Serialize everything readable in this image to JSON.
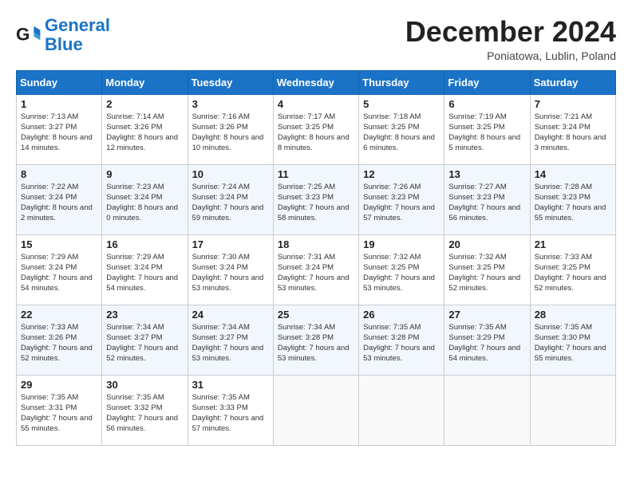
{
  "logo": {
    "line1": "General",
    "line2": "Blue"
  },
  "title": "December 2024",
  "subtitle": "Poniatowa, Lublin, Poland",
  "days_of_week": [
    "Sunday",
    "Monday",
    "Tuesday",
    "Wednesday",
    "Thursday",
    "Friday",
    "Saturday"
  ],
  "weeks": [
    [
      {
        "day": 1,
        "sunrise": "7:13 AM",
        "sunset": "3:27 PM",
        "daylight": "8 hours and 14 minutes."
      },
      {
        "day": 2,
        "sunrise": "7:14 AM",
        "sunset": "3:26 PM",
        "daylight": "8 hours and 12 minutes."
      },
      {
        "day": 3,
        "sunrise": "7:16 AM",
        "sunset": "3:26 PM",
        "daylight": "8 hours and 10 minutes."
      },
      {
        "day": 4,
        "sunrise": "7:17 AM",
        "sunset": "3:25 PM",
        "daylight": "8 hours and 8 minutes."
      },
      {
        "day": 5,
        "sunrise": "7:18 AM",
        "sunset": "3:25 PM",
        "daylight": "8 hours and 6 minutes."
      },
      {
        "day": 6,
        "sunrise": "7:19 AM",
        "sunset": "3:25 PM",
        "daylight": "8 hours and 5 minutes."
      },
      {
        "day": 7,
        "sunrise": "7:21 AM",
        "sunset": "3:24 PM",
        "daylight": "8 hours and 3 minutes."
      }
    ],
    [
      {
        "day": 8,
        "sunrise": "7:22 AM",
        "sunset": "3:24 PM",
        "daylight": "8 hours and 2 minutes."
      },
      {
        "day": 9,
        "sunrise": "7:23 AM",
        "sunset": "3:24 PM",
        "daylight": "8 hours and 0 minutes."
      },
      {
        "day": 10,
        "sunrise": "7:24 AM",
        "sunset": "3:24 PM",
        "daylight": "7 hours and 59 minutes."
      },
      {
        "day": 11,
        "sunrise": "7:25 AM",
        "sunset": "3:23 PM",
        "daylight": "7 hours and 58 minutes."
      },
      {
        "day": 12,
        "sunrise": "7:26 AM",
        "sunset": "3:23 PM",
        "daylight": "7 hours and 57 minutes."
      },
      {
        "day": 13,
        "sunrise": "7:27 AM",
        "sunset": "3:23 PM",
        "daylight": "7 hours and 56 minutes."
      },
      {
        "day": 14,
        "sunrise": "7:28 AM",
        "sunset": "3:23 PM",
        "daylight": "7 hours and 55 minutes."
      }
    ],
    [
      {
        "day": 15,
        "sunrise": "7:29 AM",
        "sunset": "3:24 PM",
        "daylight": "7 hours and 54 minutes."
      },
      {
        "day": 16,
        "sunrise": "7:29 AM",
        "sunset": "3:24 PM",
        "daylight": "7 hours and 54 minutes."
      },
      {
        "day": 17,
        "sunrise": "7:30 AM",
        "sunset": "3:24 PM",
        "daylight": "7 hours and 53 minutes."
      },
      {
        "day": 18,
        "sunrise": "7:31 AM",
        "sunset": "3:24 PM",
        "daylight": "7 hours and 53 minutes."
      },
      {
        "day": 19,
        "sunrise": "7:32 AM",
        "sunset": "3:25 PM",
        "daylight": "7 hours and 53 minutes."
      },
      {
        "day": 20,
        "sunrise": "7:32 AM",
        "sunset": "3:25 PM",
        "daylight": "7 hours and 52 minutes."
      },
      {
        "day": 21,
        "sunrise": "7:33 AM",
        "sunset": "3:25 PM",
        "daylight": "7 hours and 52 minutes."
      }
    ],
    [
      {
        "day": 22,
        "sunrise": "7:33 AM",
        "sunset": "3:26 PM",
        "daylight": "7 hours and 52 minutes."
      },
      {
        "day": 23,
        "sunrise": "7:34 AM",
        "sunset": "3:27 PM",
        "daylight": "7 hours and 52 minutes."
      },
      {
        "day": 24,
        "sunrise": "7:34 AM",
        "sunset": "3:27 PM",
        "daylight": "7 hours and 53 minutes."
      },
      {
        "day": 25,
        "sunrise": "7:34 AM",
        "sunset": "3:28 PM",
        "daylight": "7 hours and 53 minutes."
      },
      {
        "day": 26,
        "sunrise": "7:35 AM",
        "sunset": "3:28 PM",
        "daylight": "7 hours and 53 minutes."
      },
      {
        "day": 27,
        "sunrise": "7:35 AM",
        "sunset": "3:29 PM",
        "daylight": "7 hours and 54 minutes."
      },
      {
        "day": 28,
        "sunrise": "7:35 AM",
        "sunset": "3:30 PM",
        "daylight": "7 hours and 55 minutes."
      }
    ],
    [
      {
        "day": 29,
        "sunrise": "7:35 AM",
        "sunset": "3:31 PM",
        "daylight": "7 hours and 55 minutes."
      },
      {
        "day": 30,
        "sunrise": "7:35 AM",
        "sunset": "3:32 PM",
        "daylight": "7 hours and 56 minutes."
      },
      {
        "day": 31,
        "sunrise": "7:35 AM",
        "sunset": "3:33 PM",
        "daylight": "7 hours and 57 minutes."
      },
      null,
      null,
      null,
      null
    ]
  ]
}
